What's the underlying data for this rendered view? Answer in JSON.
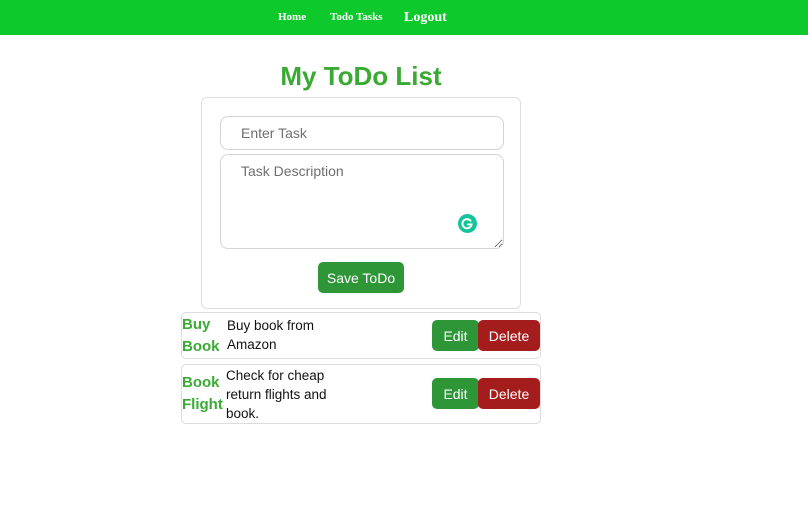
{
  "nav": {
    "home": "Home",
    "todo_tasks": "Todo Tasks",
    "logout": "Logout"
  },
  "page_title": "My ToDo List",
  "form": {
    "task_placeholder": "Enter Task",
    "task_value": "",
    "description_placeholder": "Task Description",
    "description_value": "",
    "save_label": "Save ToDo"
  },
  "todos": [
    {
      "title": "Buy Book",
      "description": "Buy book from Amazon",
      "edit_label": "Edit",
      "delete_label": "Delete"
    },
    {
      "title": "Book Flight",
      "description": "Check for cheap return flights and book.",
      "edit_label": "Edit",
      "delete_label": "Delete"
    }
  ],
  "colors": {
    "navbar": "#0dc92b",
    "title": "#3aaa35",
    "primary_button": "#2e9637",
    "danger_button": "#a51c1c",
    "grammarly": "#15c39a"
  },
  "icons": {
    "grammarly": "grammarly-icon"
  }
}
